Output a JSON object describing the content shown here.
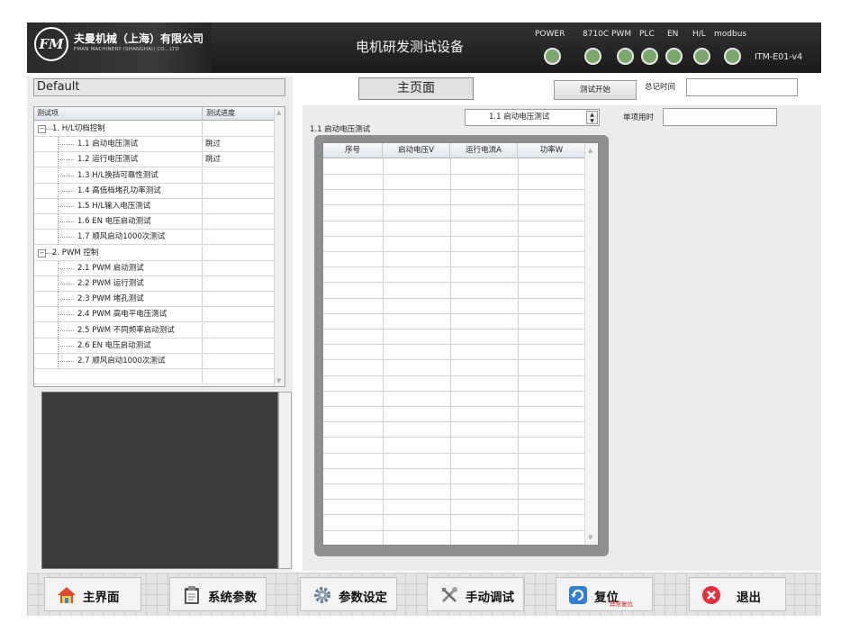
{
  "header": {
    "logo_text": "FM",
    "company_name": "夫曼机械（上海）有限公司",
    "company_en": "FMAN MACHINERY (SHANGHAI) CO., LTD",
    "title": "电机研发测试设备",
    "indicators": [
      {
        "label": "POWER",
        "color": "#7aa86a"
      },
      {
        "label": "8710C",
        "color": "#7aa86a"
      },
      {
        "label": "PWM",
        "color": "#7aa86a"
      },
      {
        "label": "PLC",
        "color": "#7aa86a"
      },
      {
        "label": "EN",
        "color": "#7aa86a"
      },
      {
        "label": "H/L",
        "color": "#7aa86a"
      },
      {
        "label": "modbus",
        "color": "#7aa86a"
      }
    ],
    "model": "ITM-E01-v4"
  },
  "profile": {
    "name": "Default"
  },
  "main_tab": {
    "label": "主页面"
  },
  "controls": {
    "start_test": "测试开始",
    "total_time_label": "总记时间",
    "total_time_value": "",
    "single_time_label": "单项用时",
    "single_time_value": ""
  },
  "tree": {
    "headers": [
      "测试项",
      "测试进度"
    ],
    "rows": [
      {
        "label": "1. H/L切档控制",
        "status": "",
        "level": 0,
        "expander": "−"
      },
      {
        "label": "1.1 启动电压测试",
        "status": "跳过",
        "level": 1
      },
      {
        "label": "1.2 运行电压测试",
        "status": "跳过",
        "level": 1
      },
      {
        "label": "1.3 H/L换挡可靠性测试",
        "status": "",
        "level": 1
      },
      {
        "label": "1.4 高低档堵孔功率测试",
        "status": "",
        "level": 1
      },
      {
        "label": "1.5 H/L输入电压测试",
        "status": "",
        "level": 1
      },
      {
        "label": "1.6 EN 电压启动测试",
        "status": "",
        "level": 1
      },
      {
        "label": "1.7 顺风启动1000次测试",
        "status": "",
        "level": 1
      },
      {
        "label": "2. PWM 控制",
        "status": "",
        "level": 0,
        "expander": "−"
      },
      {
        "label": "2.1 PWM 启动测试",
        "status": "",
        "level": 1
      },
      {
        "label": "2.2 PWM 运行测试",
        "status": "",
        "level": 1
      },
      {
        "label": "2.3 PWM 堵孔测试",
        "status": "",
        "level": 1
      },
      {
        "label": "2.4 PWM 高电平电压测试",
        "status": "",
        "level": 1
      },
      {
        "label": "2.5 PWM 不同频率启动测试",
        "status": "",
        "level": 1
      },
      {
        "label": "2.6 EN 电压启动测试",
        "status": "",
        "level": 1
      },
      {
        "label": "2.7 顺风启动1000次测试",
        "status": "",
        "level": 1
      },
      {
        "label": "",
        "status": "",
        "level": 1
      }
    ]
  },
  "test_panel": {
    "title": "1.1 启动电压测试",
    "selected_test": "1.1 启动电压测试",
    "columns": [
      "序号",
      "启动电压V",
      "运行电流A",
      "功率W"
    ],
    "rows": []
  },
  "bottom_buttons": [
    {
      "label": "主界面",
      "icon": "home-icon"
    },
    {
      "label": "系统参数",
      "icon": "clipboard-icon"
    },
    {
      "label": "参数设定",
      "icon": "gear-icon"
    },
    {
      "label": "手动调试",
      "icon": "tools-icon"
    },
    {
      "label": "复位",
      "icon": "refresh-icon",
      "sub": "异常复位"
    },
    {
      "label": "退出",
      "icon": "close-icon"
    }
  ],
  "colors": {
    "led_on": "#7aa86a",
    "header_bg": "#1f1f1f",
    "exit_red": "#e0303a",
    "reset_blue": "#2f7fd8"
  }
}
